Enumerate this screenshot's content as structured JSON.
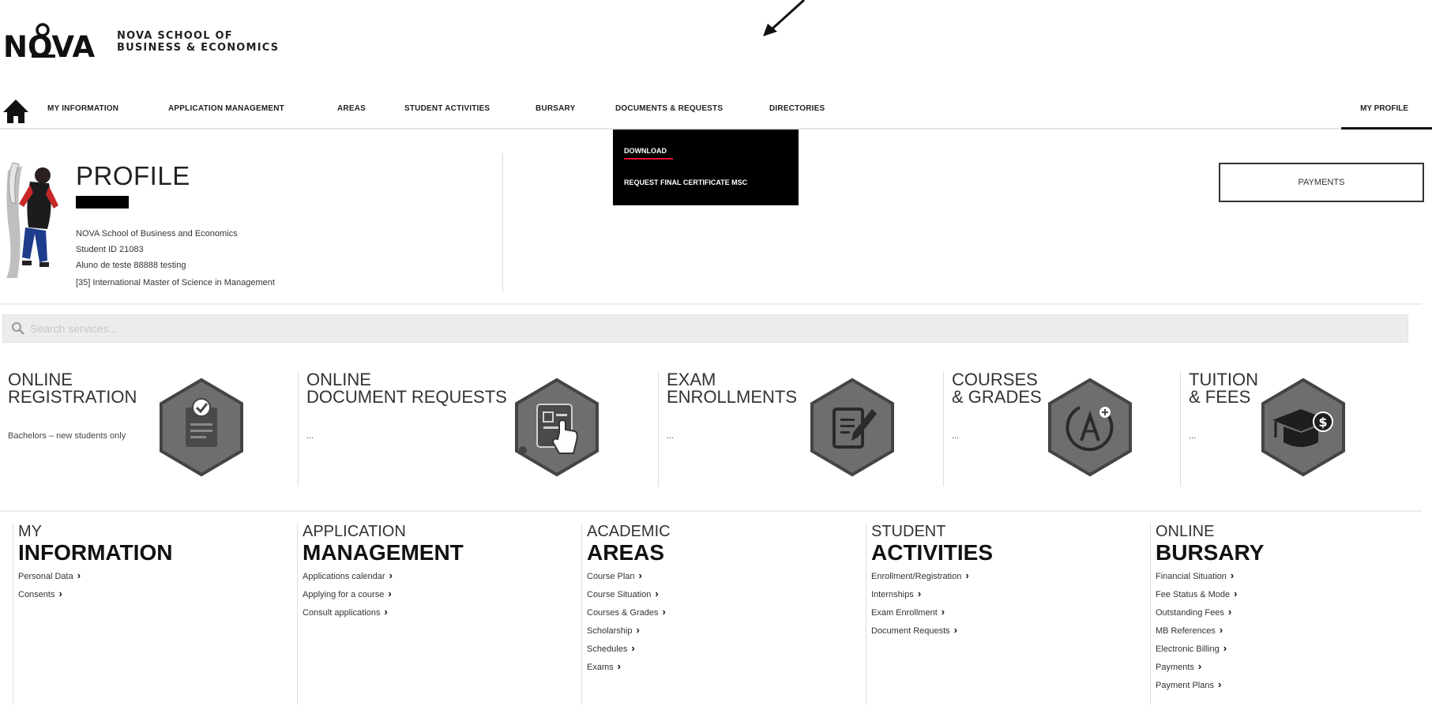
{
  "brand": {
    "logo_text": "NOVA",
    "subtitle_line1": "NOVA SCHOOL OF",
    "subtitle_line2": "BUSINESS & ECONOMICS"
  },
  "nav": {
    "home_icon": "home-icon",
    "items": [
      {
        "label": "MY INFORMATION"
      },
      {
        "label": "APPLICATION MANAGEMENT"
      },
      {
        "label": "AREAS"
      },
      {
        "label": "STUDENT ACTIVITIES"
      },
      {
        "label": "BURSARY"
      },
      {
        "label": "DOCUMENTS & REQUESTS"
      },
      {
        "label": "DIRECTORIES"
      }
    ],
    "profile_label": "MY PROFILE"
  },
  "dropdown": {
    "items": [
      {
        "label": "DOWNLOAD",
        "active": true
      },
      {
        "label": "REQUEST FINAL CERTIFICATE MSC"
      }
    ],
    "accent_color": "#e8112d"
  },
  "profile": {
    "title": "PROFILE",
    "school": "NOVA School of Business and Economics",
    "student_id": "Student ID 21083",
    "name": "Aluno de teste 88888 testing",
    "program": "[35] International Master of Science in Management"
  },
  "payments_button": "PAYMENTS",
  "search": {
    "placeholder": "Search services..."
  },
  "services": [
    {
      "title_line1": "ONLINE",
      "title_line2": "REGISTRATION",
      "desc": "Bachelors – new students only",
      "icon": "clipboard-check-icon"
    },
    {
      "title_line1": "ONLINE",
      "title_line2": "DOCUMENT REQUESTS",
      "desc": "...",
      "icon": "document-touch-icon"
    },
    {
      "title_line1": "EXAM",
      "title_line2": "ENROLLMENTS",
      "desc": "...",
      "icon": "edit-document-icon"
    },
    {
      "title_line1": "COURSES",
      "title_line2": "& GRADES",
      "desc": "...",
      "icon": "grade-a-icon"
    },
    {
      "title_line1": "TUITION",
      "title_line2": "& FEES",
      "desc": "...",
      "icon": "graduation-cap-money-icon"
    }
  ],
  "sections": [
    {
      "sub": "MY",
      "main": "INFORMATION",
      "links": [
        "Personal Data",
        "Consents"
      ]
    },
    {
      "sub": "APPLICATION",
      "main": "MANAGEMENT",
      "links": [
        "Applications calendar",
        "Applying for a course",
        "Consult applications"
      ]
    },
    {
      "sub": "ACADEMIC",
      "main": "AREAS",
      "links": [
        "Course Plan",
        "Course Situation",
        "Courses & Grades",
        "Scholarship",
        "Schedules",
        "Exams"
      ]
    },
    {
      "sub": "STUDENT",
      "main": "ACTIVITIES",
      "links": [
        "Enrollment/Registration",
        "Internships",
        "Exam Enrollment",
        "Document Requests"
      ]
    },
    {
      "sub": "ONLINE",
      "main": "BURSARY",
      "links": [
        "Financial Situation",
        "Fee Status & Mode",
        "Outstanding Fees",
        "MB References",
        "Electronic Billing",
        "Payments",
        "Payment Plans"
      ]
    }
  ],
  "colors": {
    "hex_fill": "#6e6e6e",
    "hex_border": "#444444",
    "accent_red": "#e8112d",
    "dropdown_bg": "#000000",
    "search_bg": "#ececec"
  }
}
